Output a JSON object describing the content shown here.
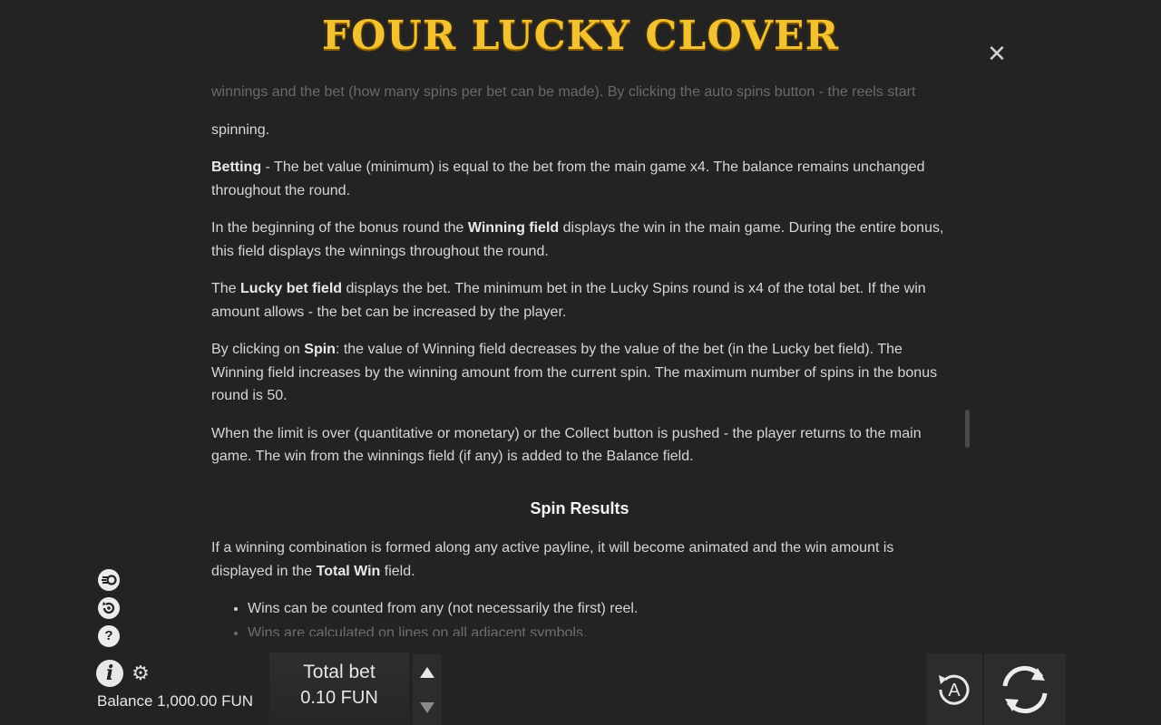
{
  "header": {
    "logo_text": "FOUR LUCKY CLOVER",
    "close_symbol": "✕"
  },
  "content": {
    "fragment_top": "winnings and the bet (how many spins per bet can be made). By clicking the auto spins button - the reels start",
    "fragment_top_tail": "spinning.",
    "betting": {
      "bold": "Betting",
      "text": " - The bet value (minimum) is equal to the bet from the main game x4. The balance remains unchanged throughout the round."
    },
    "winning_field": {
      "pre": "In the beginning of the bonus round the ",
      "bold": "Winning field",
      "post": " displays the win in the main game. During the entire bonus, this field displays the winnings throughout the round."
    },
    "lucky_bet": {
      "pre": "The ",
      "bold": "Lucky bet field",
      "post": " displays the bet. The minimum bet in the Lucky Spins round is x4 of the total bet. If the win amount allows - the bet can be increased by the player."
    },
    "spin": {
      "pre": "By clicking on ",
      "bold": "Spin",
      "post": ": the value of Winning field decreases by the value of the bet (in the Lucky bet field). The Winning field increases by the winning amount from the current spin. The maximum number of spins in the bonus round is 50."
    },
    "limit": "When the limit is over (quantitative or monetary) or the Collect button is pushed - the player returns to the main game. The win from the winnings field (if any) is added to the Balance field.",
    "section_title": "Spin Results",
    "results": {
      "pre": "If a winning combination is formed along any active payline, it will become animated and the win amount is displayed in the ",
      "bold": "Total Win",
      "post": " field."
    },
    "bullets": [
      "Wins can be counted from any (not necessarily the first) reel.",
      "Wins are calculated on lines on all adjacent symbols."
    ]
  },
  "sidebar": {
    "icons": [
      "turbo-icon",
      "autoplay-icon",
      "help-icon"
    ],
    "info_icon": "info-icon",
    "settings_icon": "gear-icon",
    "help_glyph": "?",
    "info_glyph": "i",
    "gear_glyph": "⚙"
  },
  "footer": {
    "balance_label": "Balance",
    "balance_value": "1,000.00 FUN",
    "total_bet_label": "Total bet",
    "total_bet_value": "0.10 FUN",
    "auto_label": "A"
  }
}
